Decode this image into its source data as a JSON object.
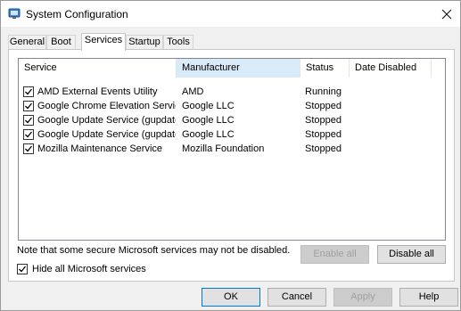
{
  "window": {
    "title": "System Configuration"
  },
  "tabs": [
    {
      "label": "General"
    },
    {
      "label": "Boot"
    },
    {
      "label": "Services"
    },
    {
      "label": "Startup"
    },
    {
      "label": "Tools"
    }
  ],
  "active_tab": "Services",
  "columns": [
    "Service",
    "Manufacturer",
    "Status",
    "Date Disabled"
  ],
  "sorted_column": "Manufacturer",
  "services": [
    {
      "checked": true,
      "service": "AMD External Events Utility",
      "manufacturer": "AMD",
      "status": "Running",
      "date_disabled": ""
    },
    {
      "checked": true,
      "service": "Google Chrome Elevation Servic...",
      "manufacturer": "Google LLC",
      "status": "Stopped",
      "date_disabled": ""
    },
    {
      "checked": true,
      "service": "Google Update Service (gupdate)",
      "manufacturer": "Google LLC",
      "status": "Stopped",
      "date_disabled": ""
    },
    {
      "checked": true,
      "service": "Google Update Service (gupdatem)",
      "manufacturer": "Google LLC",
      "status": "Stopped",
      "date_disabled": ""
    },
    {
      "checked": true,
      "service": "Mozilla Maintenance Service",
      "manufacturer": "Mozilla Foundation",
      "status": "Stopped",
      "date_disabled": ""
    }
  ],
  "note": "Note that some secure Microsoft services may not be disabled.",
  "buttons": {
    "enable_all": "Enable all",
    "disable_all": "Disable all",
    "ok": "OK",
    "cancel": "Cancel",
    "apply": "Apply",
    "help": "Help"
  },
  "hide_ms": {
    "label": "Hide all Microsoft services",
    "checked": true
  }
}
